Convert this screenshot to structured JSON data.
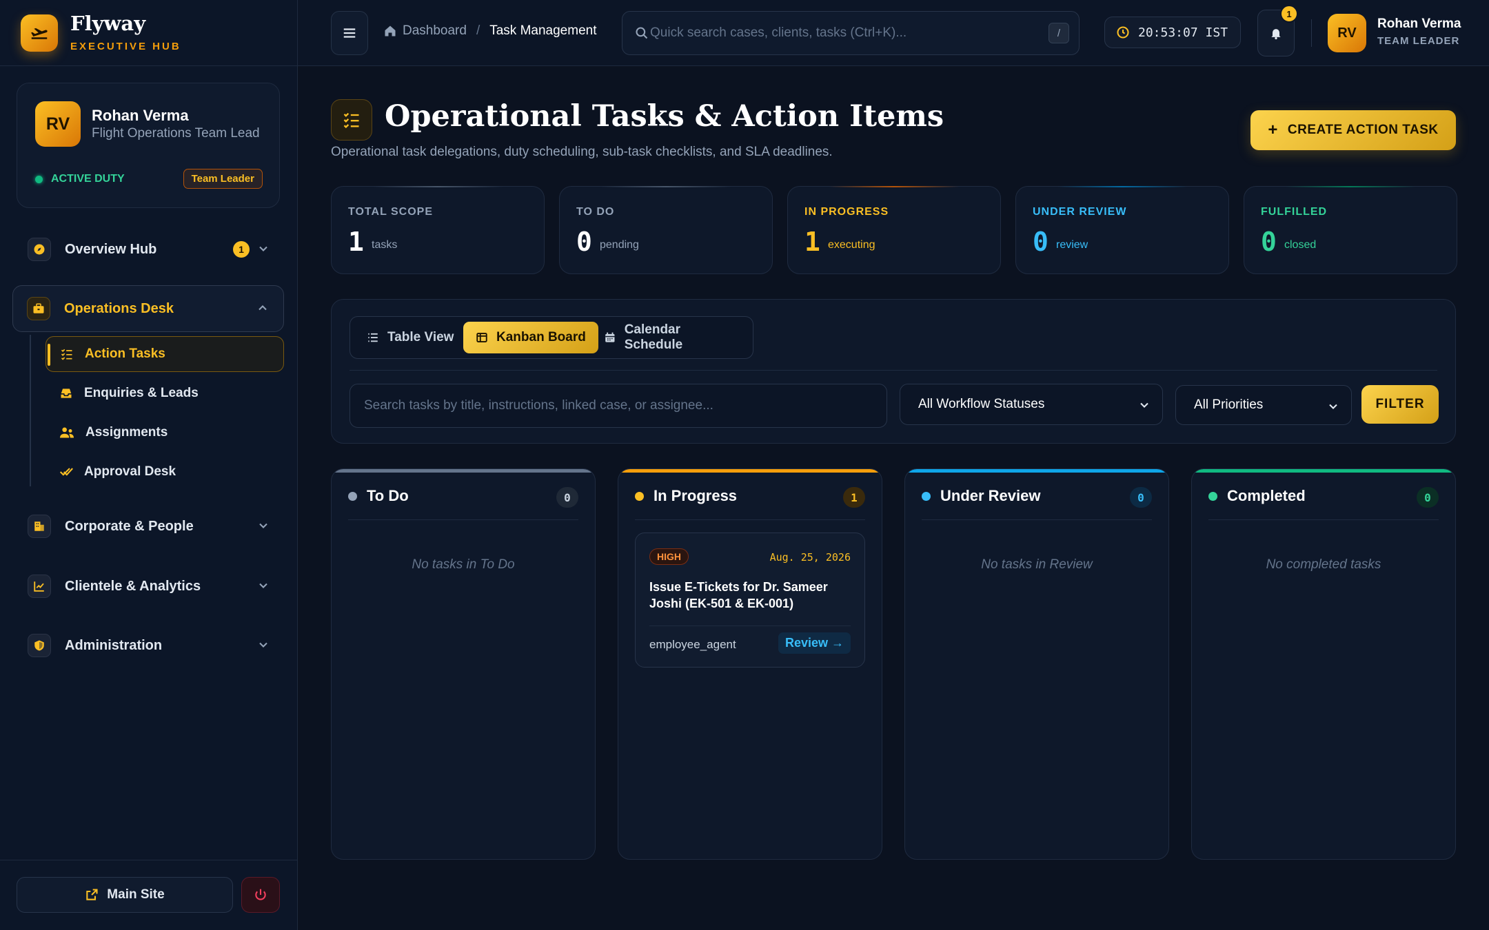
{
  "brand": {
    "name": "Flyway",
    "subtitle": "EXECUTIVE HUB"
  },
  "profile": {
    "initials": "RV",
    "name": "Rohan Verma",
    "role": "Flight Operations Team Lead",
    "status": "ACTIVE DUTY",
    "badge": "Team Leader"
  },
  "nav": {
    "overview": {
      "label": "Overview Hub",
      "count": "1"
    },
    "operations": {
      "label": "Operations Desk"
    },
    "sub": {
      "action_tasks": "Action Tasks",
      "enquiries": "Enquiries & Leads",
      "assignments": "Assignments",
      "approval": "Approval Desk"
    },
    "corporate": {
      "label": "Corporate & People"
    },
    "clientele": {
      "label": "Clientele & Analytics"
    },
    "admin": {
      "label": "Administration"
    }
  },
  "footer": {
    "main_site": "Main Site"
  },
  "topbar": {
    "breadcrumb_home": "Dashboard",
    "breadcrumb_sep": "/",
    "breadcrumb_current": "Task Management",
    "search_placeholder": "Quick search cases, clients, tasks (Ctrl+K)...",
    "search_kbd": "/",
    "clock": "20:53:07 IST",
    "notif_count": "1",
    "user_initials": "RV",
    "user_name": "Rohan Verma",
    "user_role": "TEAM LEADER"
  },
  "page": {
    "title": "Operational Tasks & Action Items",
    "subtitle": "Operational task delegations, duty scheduling, sub-task checklists, and SLA deadlines.",
    "create_button": "CREATE ACTION TASK"
  },
  "stats": [
    {
      "label": "TOTAL SCOPE",
      "value": "1",
      "unit": "tasks",
      "color": "#94a3b8",
      "value_color": "#ffffff"
    },
    {
      "label": "TO DO",
      "value": "0",
      "unit": "pending",
      "color": "#94a3b8",
      "value_color": "#ffffff"
    },
    {
      "label": "IN PROGRESS",
      "value": "1",
      "unit": "executing",
      "color": "#fbbf24",
      "value_color": "#fbbf24"
    },
    {
      "label": "UNDER REVIEW",
      "value": "0",
      "unit": "review",
      "color": "#38bdf8",
      "value_color": "#38bdf8"
    },
    {
      "label": "FULFILLED",
      "value": "0",
      "unit": "closed",
      "color": "#34d399",
      "value_color": "#34d399"
    }
  ],
  "views": {
    "table": "Table View",
    "kanban": "Kanban Board",
    "calendar": "Calendar Schedule"
  },
  "filters": {
    "search_placeholder": "Search tasks by title, instructions, linked case, or assignee...",
    "status_value": "All Workflow Statuses",
    "priority_value": "All Priorities",
    "filter_button": "FILTER"
  },
  "columns": [
    {
      "title": "To Do",
      "count": "0",
      "empty": "No tasks in To Do",
      "color": "#94a3b8"
    },
    {
      "title": "In Progress",
      "count": "1",
      "empty": "",
      "color": "#fbbf24"
    },
    {
      "title": "Under Review",
      "count": "0",
      "empty": "No tasks in Review",
      "color": "#38bdf8"
    },
    {
      "title": "Completed",
      "count": "0",
      "empty": "No completed tasks",
      "color": "#34d399"
    }
  ],
  "task": {
    "priority": "HIGH",
    "date": "Aug. 25, 2026",
    "title": "Issue E-Tickets for Dr. Sameer Joshi (EK-501 & EK-001)",
    "assignee": "employee_agent",
    "action": "Review →"
  }
}
